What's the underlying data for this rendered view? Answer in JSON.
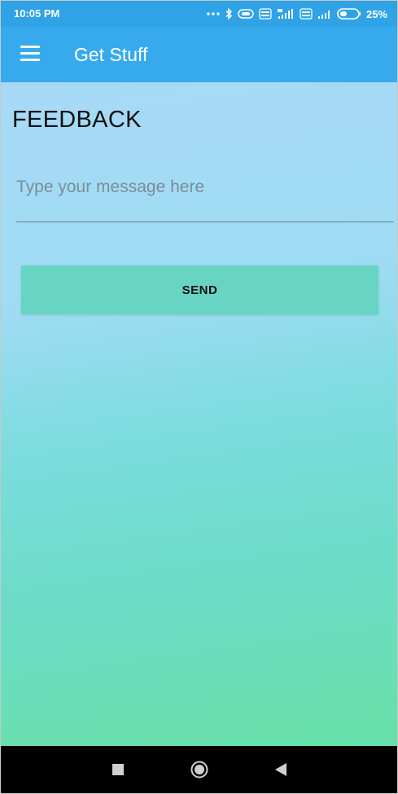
{
  "status_bar": {
    "time": "10:05 PM",
    "battery_percent": "25%",
    "icons": [
      "more-dots-icon",
      "bluetooth-icon",
      "vibrate-icon",
      "volte-icon",
      "signal-4g-icon",
      "volte-icon",
      "signal-icon",
      "battery-icon"
    ]
  },
  "app_bar": {
    "title": "Get Stuff",
    "menu_icon": "hamburger-menu-icon"
  },
  "main": {
    "heading": "FEEDBACK",
    "message_placeholder": "Type your message here",
    "message_value": "",
    "send_label": "SEND"
  },
  "nav_bar": {
    "icons": [
      "recents-square-icon",
      "home-circle-icon",
      "back-triangle-icon"
    ]
  },
  "colors": {
    "status_bar": "#2fa3e6",
    "app_bar": "#36aaec",
    "send_button": "#68d4c4",
    "gradient_top": "#a7d9f6",
    "gradient_bottom": "#68e0a8"
  }
}
